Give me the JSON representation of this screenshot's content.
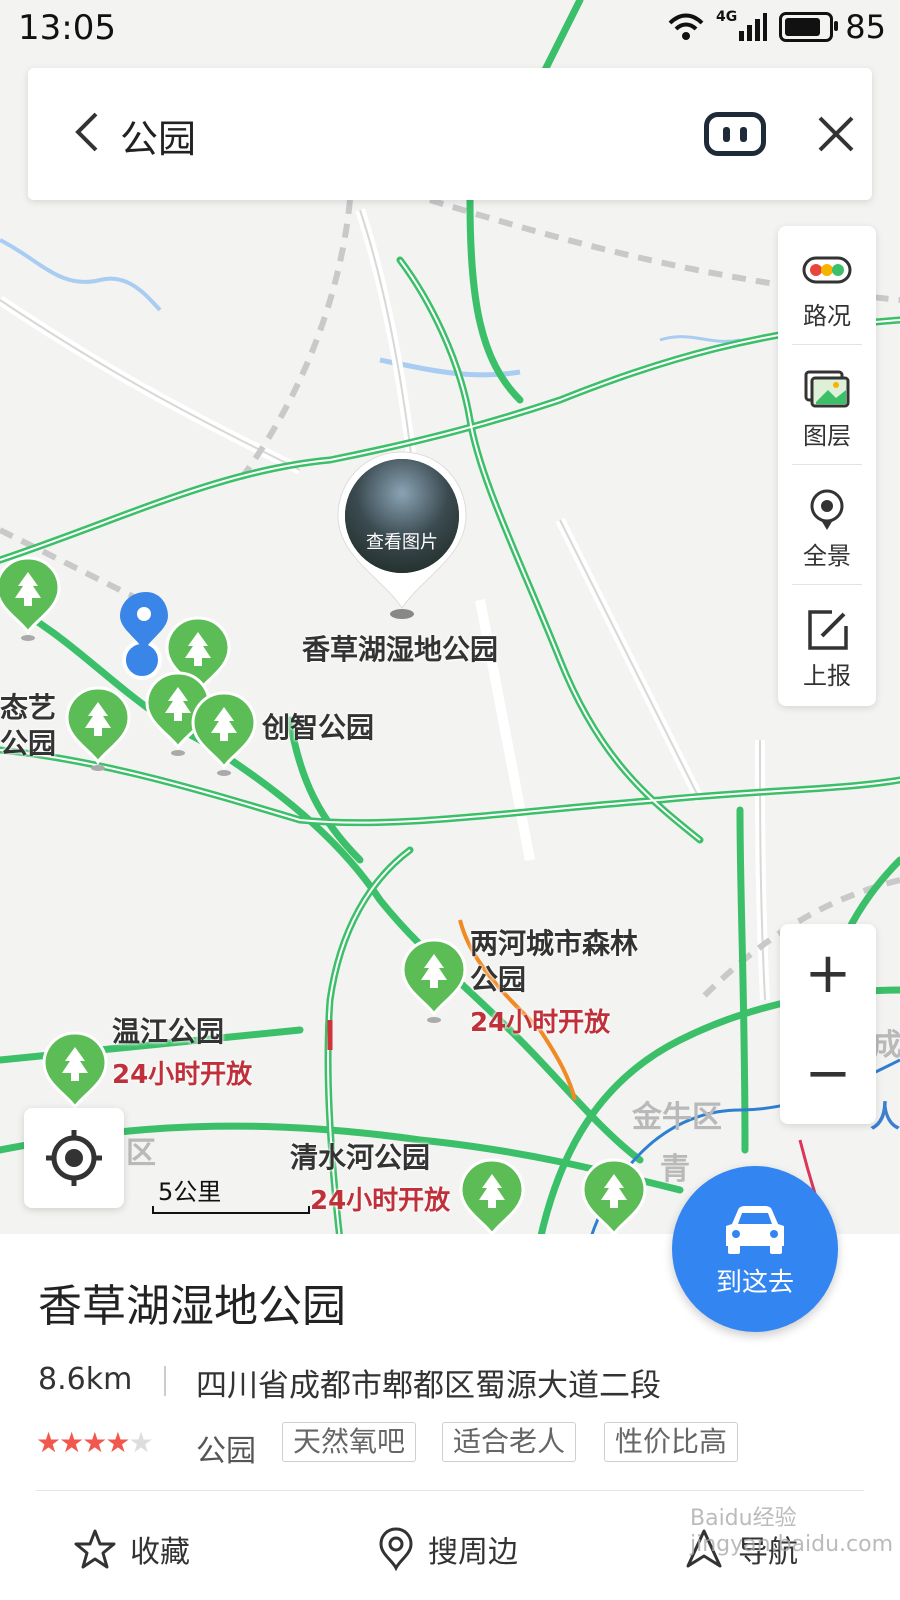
{
  "status_bar": {
    "time": "13:05",
    "network": "4G",
    "battery": "85"
  },
  "search": {
    "query": "公园"
  },
  "toolbar": {
    "traffic": "路况",
    "layers": "图层",
    "panorama": "全景",
    "report": "上报"
  },
  "map": {
    "photo_label": "查看图片",
    "selected_place": "香草湖湿地公园",
    "places": [
      {
        "name": "态艺",
        "name2": "公园"
      },
      {
        "name": "创智公园"
      },
      {
        "name": "两河城市森林",
        "name2": "公园",
        "hours": "24小时开放"
      },
      {
        "name": "温江公园",
        "hours": "24小时开放"
      },
      {
        "name": "清水河公园",
        "hours": "24小时开放"
      }
    ],
    "district_labels": [
      "金牛区",
      "区",
      "青",
      "成",
      "人"
    ],
    "scale": "5公里"
  },
  "zoom": {
    "in": "+",
    "out": "−"
  },
  "card": {
    "name": "香草湖湿地公园",
    "distance": "8.6km",
    "address": "四川省成都市郫都区蜀源大道二段",
    "rating": 4,
    "rating_max": 5,
    "category": "公园",
    "tags": [
      "天然氧吧",
      "适合老人",
      "性价比高"
    ],
    "actions": {
      "favorite": "收藏",
      "nearby": "搜周边",
      "navigate": "导航"
    },
    "go_here": "到这去"
  },
  "watermark": "Baidu经验 jingyan.baidu.com",
  "colors": {
    "road_green": "#3cbf69",
    "accent_blue": "#3385f2",
    "poi_green": "#5cbc55",
    "hours_red": "#c0303a"
  }
}
